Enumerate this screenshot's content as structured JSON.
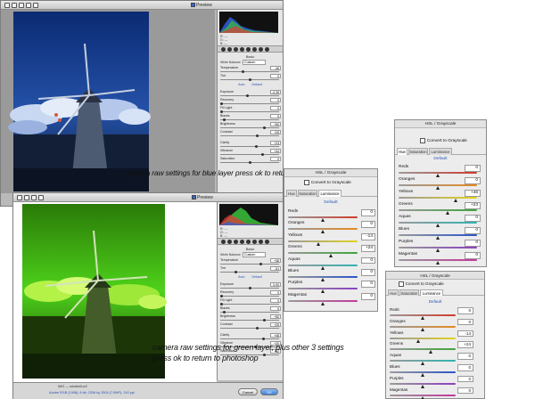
{
  "windows": [
    {
      "id": "blue",
      "preview_label": "Preview",
      "basic": {
        "title": "Basic",
        "white_balance_label": "White Balance:",
        "white_balance_value": "Custom",
        "auto_label": "Auto",
        "default_label": "Default",
        "rows": [
          {
            "label": "Temperature",
            "value": "-46",
            "level": 0.38
          },
          {
            "label": "Tint",
            "value": "0",
            "level": 0.5
          },
          {
            "label": "Exposure",
            "value": "-0.35",
            "level": 0.46
          },
          {
            "label": "Recovery",
            "value": "0",
            "level": 0.0
          },
          {
            "label": "Fill Light",
            "value": "0",
            "level": 0.0
          },
          {
            "label": "Blacks",
            "value": "5",
            "level": 0.05
          },
          {
            "label": "Brightness",
            "value": "+50",
            "level": 0.75
          },
          {
            "label": "Contrast",
            "value": "+25",
            "level": 0.62
          },
          {
            "label": "Clarity",
            "value": "+23",
            "level": 0.61
          },
          {
            "label": "Vibrance",
            "value": "+44",
            "level": 0.72
          },
          {
            "label": "Saturation",
            "value": "0",
            "level": 0.5
          }
        ]
      },
      "caption": "camera raw settings for blue layer press ok to return to photoshop"
    },
    {
      "id": "green",
      "preview_label": "Preview",
      "basic": {
        "title": "Basic",
        "white_balance_label": "White Balance:",
        "white_balance_value": "Custom",
        "auto_label": "Auto",
        "default_label": "Default",
        "rows": [
          {
            "label": "Temperature",
            "value": "+38",
            "level": 0.69
          },
          {
            "label": "Tint",
            "value": "-51",
            "level": 0.25
          },
          {
            "label": "Exposure",
            "value": "0.00",
            "level": 0.5
          },
          {
            "label": "Recovery",
            "value": "0",
            "level": 0.0
          },
          {
            "label": "Fill Light",
            "value": "0",
            "level": 0.0
          },
          {
            "label": "Blacks",
            "value": "5",
            "level": 0.05
          },
          {
            "label": "Brightness",
            "value": "+50",
            "level": 0.75
          },
          {
            "label": "Contrast",
            "value": "+25",
            "level": 0.62
          },
          {
            "label": "Clarity",
            "value": "+48",
            "level": 0.74
          },
          {
            "label": "Vibrance",
            "value": "+20",
            "level": 0.6
          },
          {
            "label": "Saturation",
            "value": "+50",
            "level": 0.75
          }
        ]
      },
      "caption_lines": [
        "camera raw settings for green layer, plus other 3 settings",
        "press ok to return to photoshop"
      ],
      "bottom": {
        "file_label": "IMG — windmill.cr2",
        "workflow_link": "Adobe RGB (1998); 8 bit; 2336 by 3504 (7.9MP); 240 ppi",
        "cancel": "Cancel",
        "ok": "OK"
      }
    }
  ],
  "hsl_panels": [
    {
      "id": "hsl-center",
      "title": "HSL / Grayscale",
      "convert_label": "Convert to Grayscale",
      "tabs": [
        "Hue",
        "Saturation",
        "Luminance"
      ],
      "active_tab": 2,
      "default_label": "Default",
      "rows": [
        {
          "label": "Reds",
          "value": "0",
          "level": 0.5
        },
        {
          "label": "Oranges",
          "value": "0",
          "level": 0.5
        },
        {
          "label": "Yellows",
          "value": "-14",
          "level": 0.43
        },
        {
          "label": "Greens",
          "value": "+24",
          "level": 0.62
        },
        {
          "label": "Aquas",
          "value": "0",
          "level": 0.5
        },
        {
          "label": "Blues",
          "value": "0",
          "level": 0.5
        },
        {
          "label": "Purples",
          "value": "0",
          "level": 0.5
        },
        {
          "label": "Magentas",
          "value": "0",
          "level": 0.5
        }
      ]
    },
    {
      "id": "hsl-right-top",
      "title": "HSL / Grayscale",
      "convert_label": "Convert to Grayscale",
      "tabs": [
        "Hue",
        "Saturation",
        "Luminance"
      ],
      "active_tab": 0,
      "default_label": "Default",
      "rows": [
        {
          "label": "Reds",
          "value": "0",
          "level": 0.5
        },
        {
          "label": "Oranges",
          "value": "0",
          "level": 0.5
        },
        {
          "label": "Yellows",
          "value": "+46",
          "level": 0.73
        },
        {
          "label": "Greens",
          "value": "+23",
          "level": 0.62
        },
        {
          "label": "Aquas",
          "value": "0",
          "level": 0.5
        },
        {
          "label": "Blues",
          "value": "0",
          "level": 0.5
        },
        {
          "label": "Purples",
          "value": "0",
          "level": 0.5
        },
        {
          "label": "Magentas",
          "value": "0",
          "level": 0.5
        }
      ]
    },
    {
      "id": "hsl-right-bottom",
      "title": "HSL / Grayscale",
      "convert_label": "Convert to Grayscale",
      "tabs": [
        "Hue",
        "Saturation",
        "Luminance"
      ],
      "active_tab": 2,
      "default_label": "Default",
      "rows": [
        {
          "label": "Reds",
          "value": "0",
          "level": 0.5
        },
        {
          "label": "Oranges",
          "value": "0",
          "level": 0.5
        },
        {
          "label": "Yellows",
          "value": "-14",
          "level": 0.43
        },
        {
          "label": "Greens",
          "value": "+24",
          "level": 0.62
        },
        {
          "label": "Aquas",
          "value": "0",
          "level": 0.5
        },
        {
          "label": "Blues",
          "value": "0",
          "level": 0.5
        },
        {
          "label": "Purples",
          "value": "0",
          "level": 0.5
        },
        {
          "label": "Magentas",
          "value": "0",
          "level": 0.5
        }
      ]
    }
  ],
  "slider_colors": {
    "Reds": "#d23a2a",
    "Oranges": "#e58a22",
    "Yellows": "#e2d21f",
    "Greens": "#3da53a",
    "Aquas": "#2fb3b0",
    "Blues": "#2b55c8",
    "Purples": "#8a3fc0",
    "Magentas": "#c2389c"
  },
  "icons": [
    "zoom-icon",
    "hand-icon",
    "white-balance-icon",
    "color-sampler-icon",
    "crop-icon",
    "straighten-icon",
    "retouch-icon",
    "red-eye-icon",
    "preferences-icon",
    "rotate-left-icon",
    "rotate-right-icon"
  ]
}
